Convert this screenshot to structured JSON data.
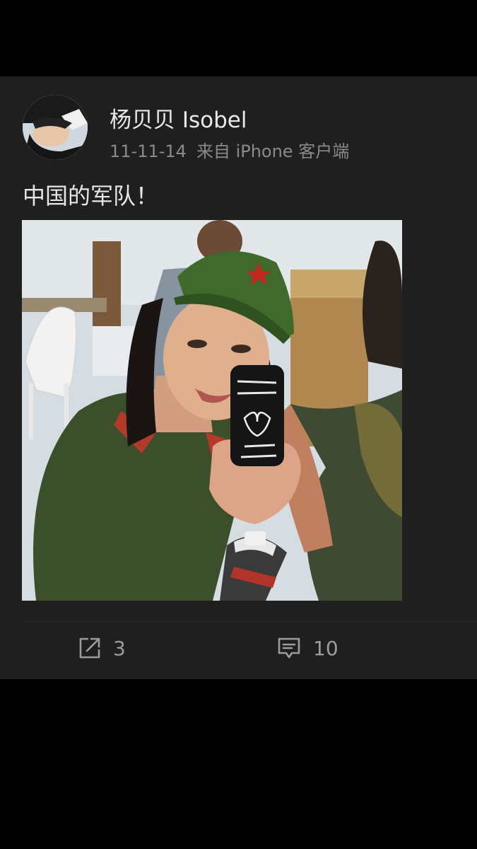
{
  "post": {
    "username": "杨贝贝 Isobel",
    "date": "11-11-14",
    "source": "来自 iPhone 客户端",
    "text": "中国的军队！",
    "avatar_icon": "avatar-photo",
    "photo_icon": "selfie-photo"
  },
  "actions": {
    "share": {
      "icon": "share-icon",
      "count": "3"
    },
    "comment": {
      "icon": "comment-icon",
      "count": "10"
    }
  }
}
